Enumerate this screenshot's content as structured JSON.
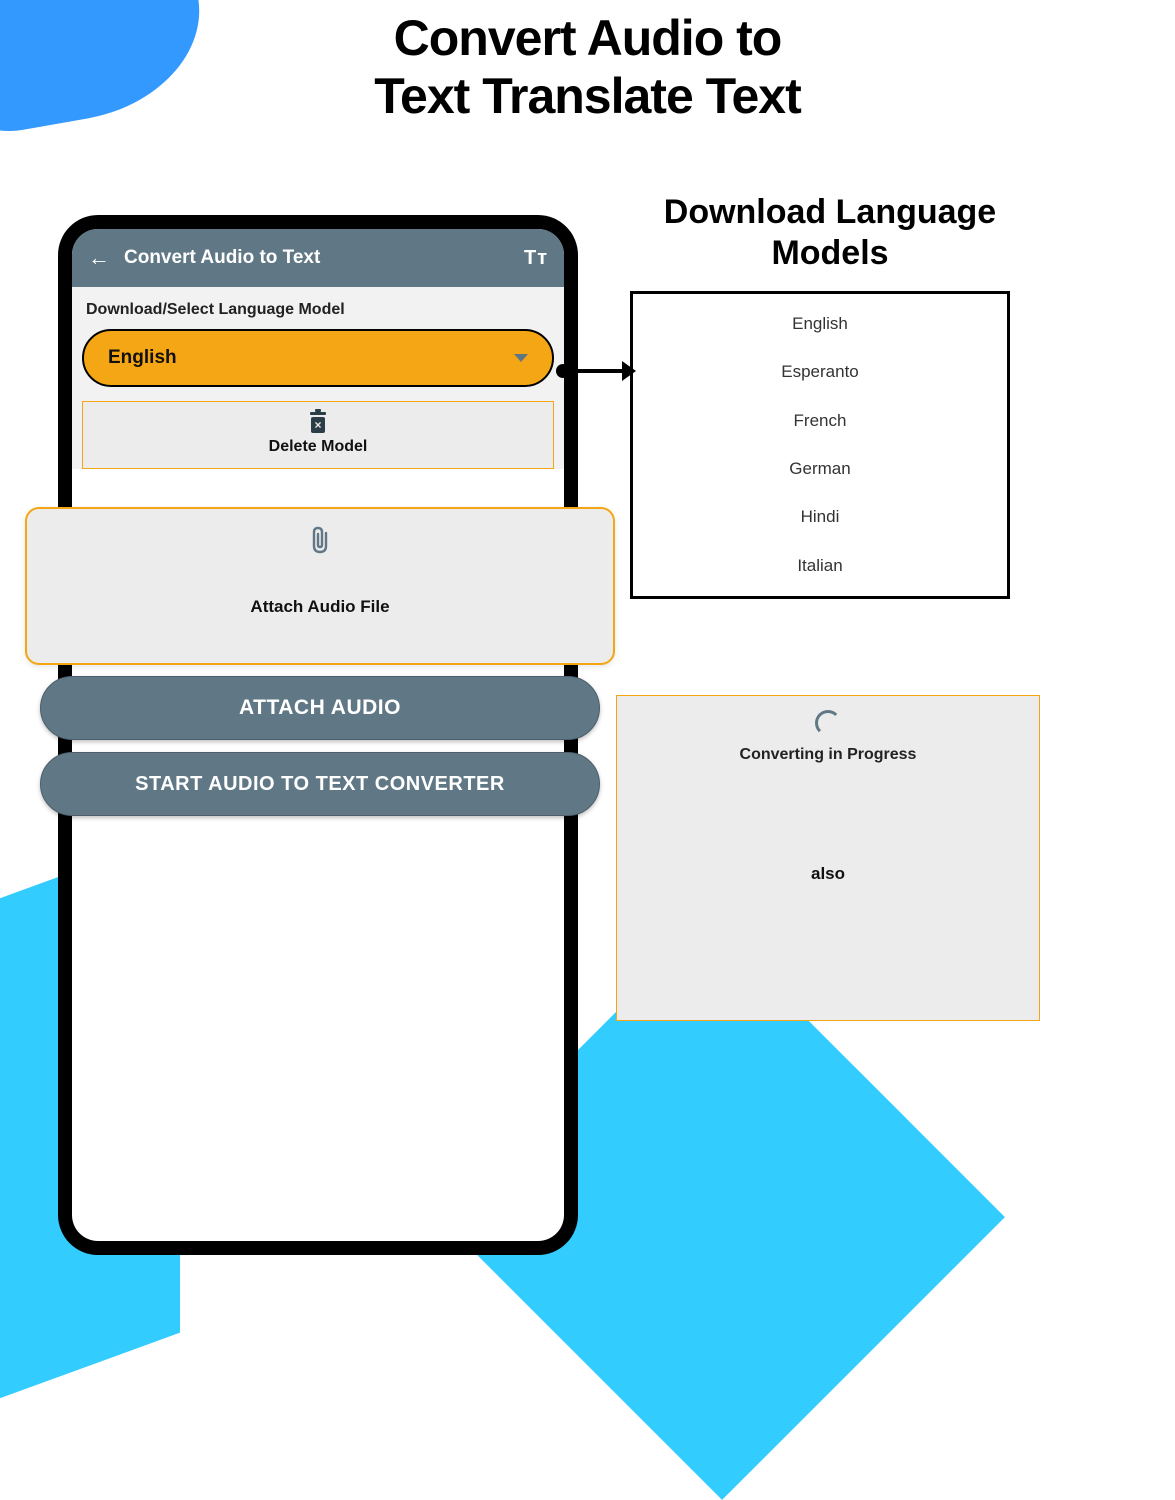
{
  "page": {
    "title_line1": "Convert Audio to",
    "title_line2": "Text Translate Text"
  },
  "phone": {
    "header_title": "Convert Audio to Text",
    "text_size_icon": "Tᴛ",
    "section_label": "Download/Select Language Model",
    "selected_language": "English",
    "delete_label": "Delete Model",
    "attach_label": "Attach Audio File",
    "attach_button": "ATTACH AUDIO",
    "start_button": "START AUDIO TO TEXT CONVERTER"
  },
  "models": {
    "title_line1": "Download Language",
    "title_line2": "Models",
    "list": [
      "English",
      "Esperanto",
      "French",
      "German",
      "Hindi",
      "Italian"
    ]
  },
  "progress": {
    "status": "Converting in Progress",
    "result_text": "also"
  }
}
